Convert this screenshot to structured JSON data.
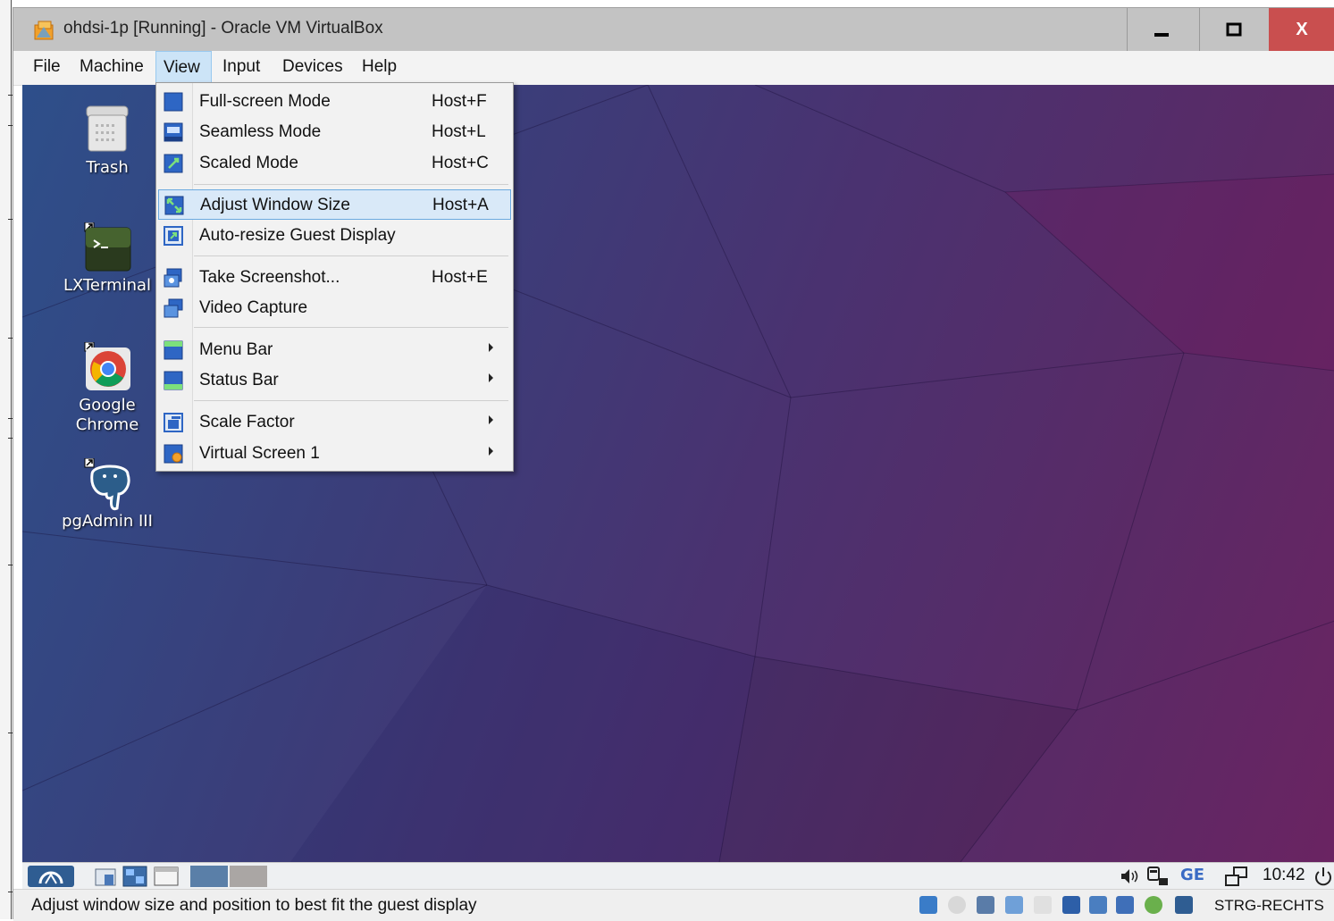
{
  "window": {
    "title": "ohdsi-1p [Running] - Oracle VM VirtualBox",
    "close_label": "X"
  },
  "menubar": {
    "items": [
      "File",
      "Machine",
      "View",
      "Input",
      "Devices",
      "Help"
    ],
    "active": "View"
  },
  "desktop_icons": [
    {
      "label": "Trash",
      "icon": "trash-icon"
    },
    {
      "label": "LXTerminal",
      "icon": "terminal-icon"
    },
    {
      "label": "Google Chrome",
      "icon": "chrome-icon"
    },
    {
      "label": "pgAdmin III",
      "icon": "pgadmin-icon"
    }
  ],
  "view_menu": {
    "items": [
      {
        "label": "Full-screen Mode",
        "shortcut": "Host+F",
        "icon": "fullscreen-icon"
      },
      {
        "label": "Seamless Mode",
        "shortcut": "Host+L",
        "icon": "seamless-icon"
      },
      {
        "label": "Scaled Mode",
        "shortcut": "Host+C",
        "icon": "scaled-icon"
      },
      {
        "label": "Adjust Window Size",
        "shortcut": "Host+A",
        "icon": "adjust-window-icon",
        "highlighted": true
      },
      {
        "label": "Auto-resize Guest Display",
        "shortcut": "",
        "icon": "auto-resize-icon"
      },
      {
        "label": "Take Screenshot...",
        "shortcut": "Host+E",
        "icon": "screenshot-icon"
      },
      {
        "label": "Video Capture",
        "shortcut": "",
        "icon": "video-capture-icon"
      },
      {
        "label": "Menu Bar",
        "shortcut": "",
        "icon": "menu-bar-icon",
        "submenu": true
      },
      {
        "label": "Status Bar",
        "shortcut": "",
        "icon": "status-bar-icon",
        "submenu": true
      },
      {
        "label": "Scale Factor",
        "shortcut": "",
        "icon": "scale-factor-icon",
        "submenu": true
      },
      {
        "label": "Virtual Screen 1",
        "shortcut": "",
        "icon": "virtual-screen-icon",
        "submenu": true
      }
    ]
  },
  "guest_panel": {
    "keyboard_layout": "GE",
    "clock": "10:42"
  },
  "statusbar": {
    "message": "Adjust window size and position to best fit the guest display",
    "host_key": "STRG-RECHTS"
  },
  "colors": {
    "accent_highlight": "#d9e9f8",
    "close_button": "#c94f4f",
    "desktop_start": "#2e4f8a",
    "desktop_end": "#6a2462"
  }
}
